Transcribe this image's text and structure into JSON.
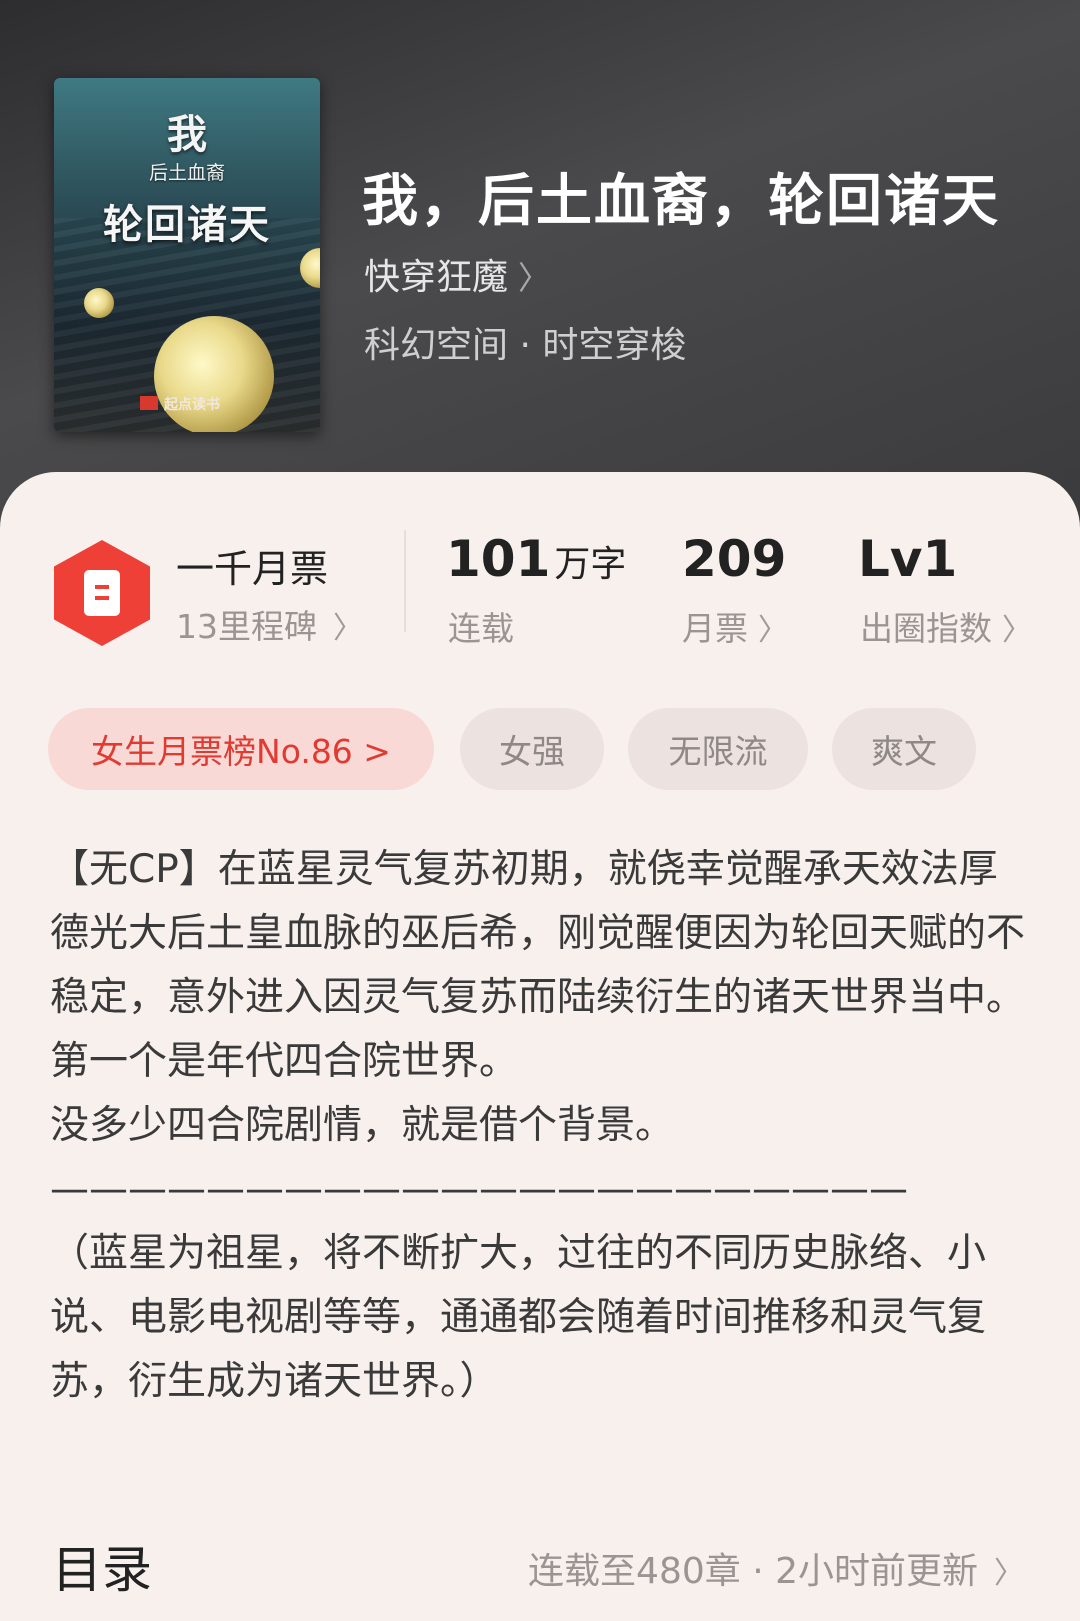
{
  "book": {
    "cover": {
      "line1": "我",
      "line2": "后土血裔",
      "line3": "轮回诸天",
      "publisher": "起点读书"
    },
    "title": "我，后土血裔，轮回诸天",
    "author": "快穿狂魔",
    "category": "科幻空间 · 时空穿梭"
  },
  "stats": {
    "badge": {
      "primary": "一千月票",
      "secondary": "13里程碑"
    },
    "words": {
      "value": "101",
      "unit": "万字",
      "label": "连载"
    },
    "tickets": {
      "value": "209",
      "label": "月票"
    },
    "influence": {
      "value": "Lv1",
      "label": "出圈指数"
    }
  },
  "tags": [
    "女生月票榜No.86 >",
    "女强",
    "无限流",
    "爽文"
  ],
  "description": "【无CP】在蓝星灵气复苏初期，就侥幸觉醒承天效法厚德光大后土皇血脉的巫后希，刚觉醒便因为轮回天赋的不稳定，意外进入因灵气复苏而陆续衍生的诸天世界当中。\n第一个是年代四合院世界。\n没多少四合院剧情，就是借个背景。\n——————————————————————\n（蓝星为祖星，将不断扩大，过往的不同历史脉络、小说、电影电视剧等等，通通都会随着时间推移和灵气复苏，衍生成为诸天世界。）",
  "toc": {
    "title": "目录",
    "status": "连载至480章 · 2小时前更新"
  },
  "colors": {
    "accent": "#ee4037",
    "panel_bg": "#f8f0ed",
    "header_bg": "#3a3a3c"
  }
}
